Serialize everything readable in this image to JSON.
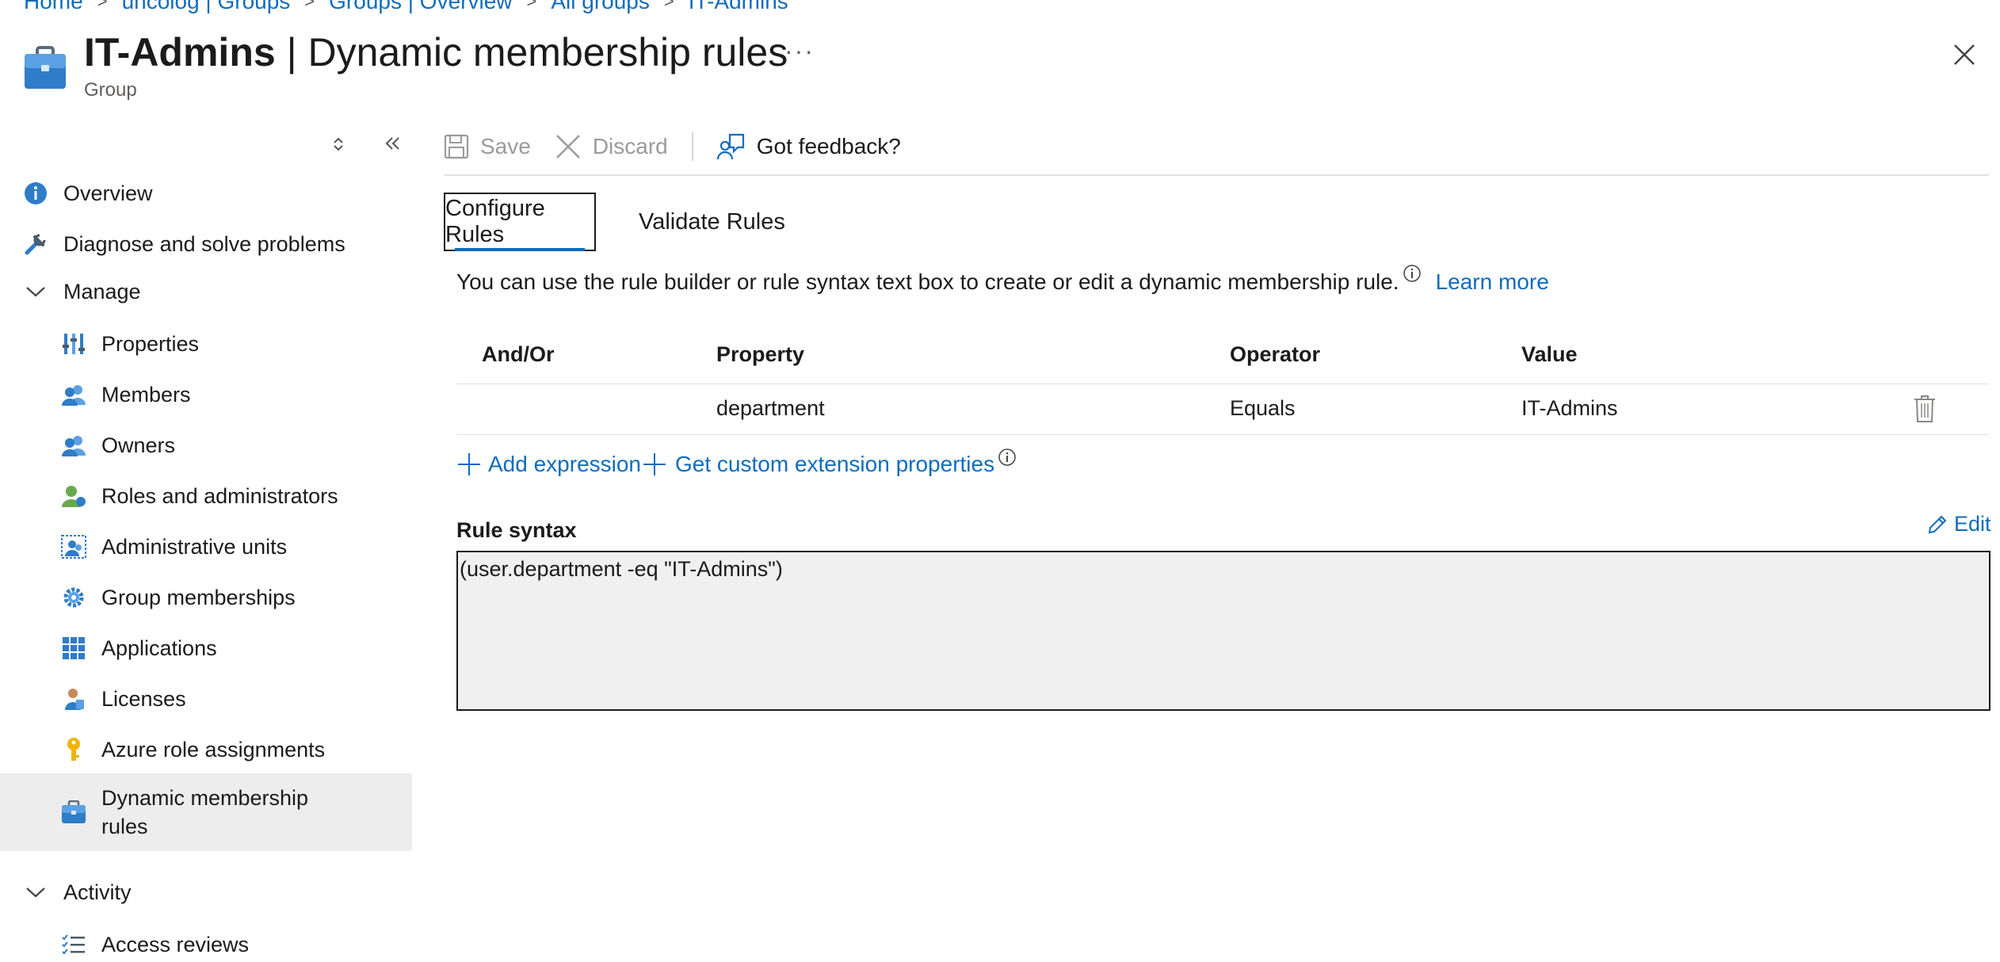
{
  "breadcrumb": [
    "Home",
    "uncolog | Groups",
    "Groups | Overview",
    "All groups",
    "IT-Admins"
  ],
  "header": {
    "title_bold": "IT-Admins",
    "title_rest": " | Dynamic membership rules",
    "subtitle": "Group",
    "more": "···"
  },
  "sidebar": {
    "items": [
      {
        "label": "Overview",
        "icon": "info-icon"
      },
      {
        "label": "Diagnose and solve problems",
        "icon": "wrench-icon"
      },
      {
        "label": "Manage",
        "icon": "chevron-down-icon"
      },
      {
        "label": "Properties",
        "icon": "properties-icon"
      },
      {
        "label": "Members",
        "icon": "members-icon"
      },
      {
        "label": "Owners",
        "icon": "owners-icon"
      },
      {
        "label": "Roles and administrators",
        "icon": "roles-icon"
      },
      {
        "label": "Administrative units",
        "icon": "admin-units-icon"
      },
      {
        "label": "Group memberships",
        "icon": "gear-icon"
      },
      {
        "label": "Applications",
        "icon": "apps-grid-icon"
      },
      {
        "label": "Licenses",
        "icon": "licenses-icon"
      },
      {
        "label": "Azure role assignments",
        "icon": "key-icon"
      },
      {
        "label": "Dynamic membership rules",
        "icon": "briefcase-icon"
      },
      {
        "label": "Activity",
        "icon": "chevron-down-icon"
      },
      {
        "label": "Access reviews",
        "icon": "checklist-icon"
      }
    ]
  },
  "toolbar": {
    "save_label": "Save",
    "discard_label": "Discard",
    "feedback_label": "Got feedback?"
  },
  "tabs": {
    "configure": "Configure Rules",
    "validate": "Validate Rules"
  },
  "description": {
    "text": "You can use the rule builder or rule syntax text box to create or edit a dynamic membership rule.",
    "learn_more": "Learn more"
  },
  "table": {
    "headers": [
      "And/Or",
      "Property",
      "Operator",
      "Value"
    ],
    "rows": [
      {
        "and_or": "",
        "property": "department",
        "operator": "Equals",
        "value": "IT-Admins"
      }
    ]
  },
  "actions": {
    "add_expression": "Add expression",
    "custom_extension": "Get custom extension properties"
  },
  "rule_syntax": {
    "label": "Rule syntax",
    "edit_label": "Edit",
    "value": "(user.department -eq \"IT-Admins\")"
  },
  "colors": {
    "accent": "#0f6cbd",
    "selected_bg": "#ededed",
    "syntax_bg": "#f0f0f0"
  }
}
